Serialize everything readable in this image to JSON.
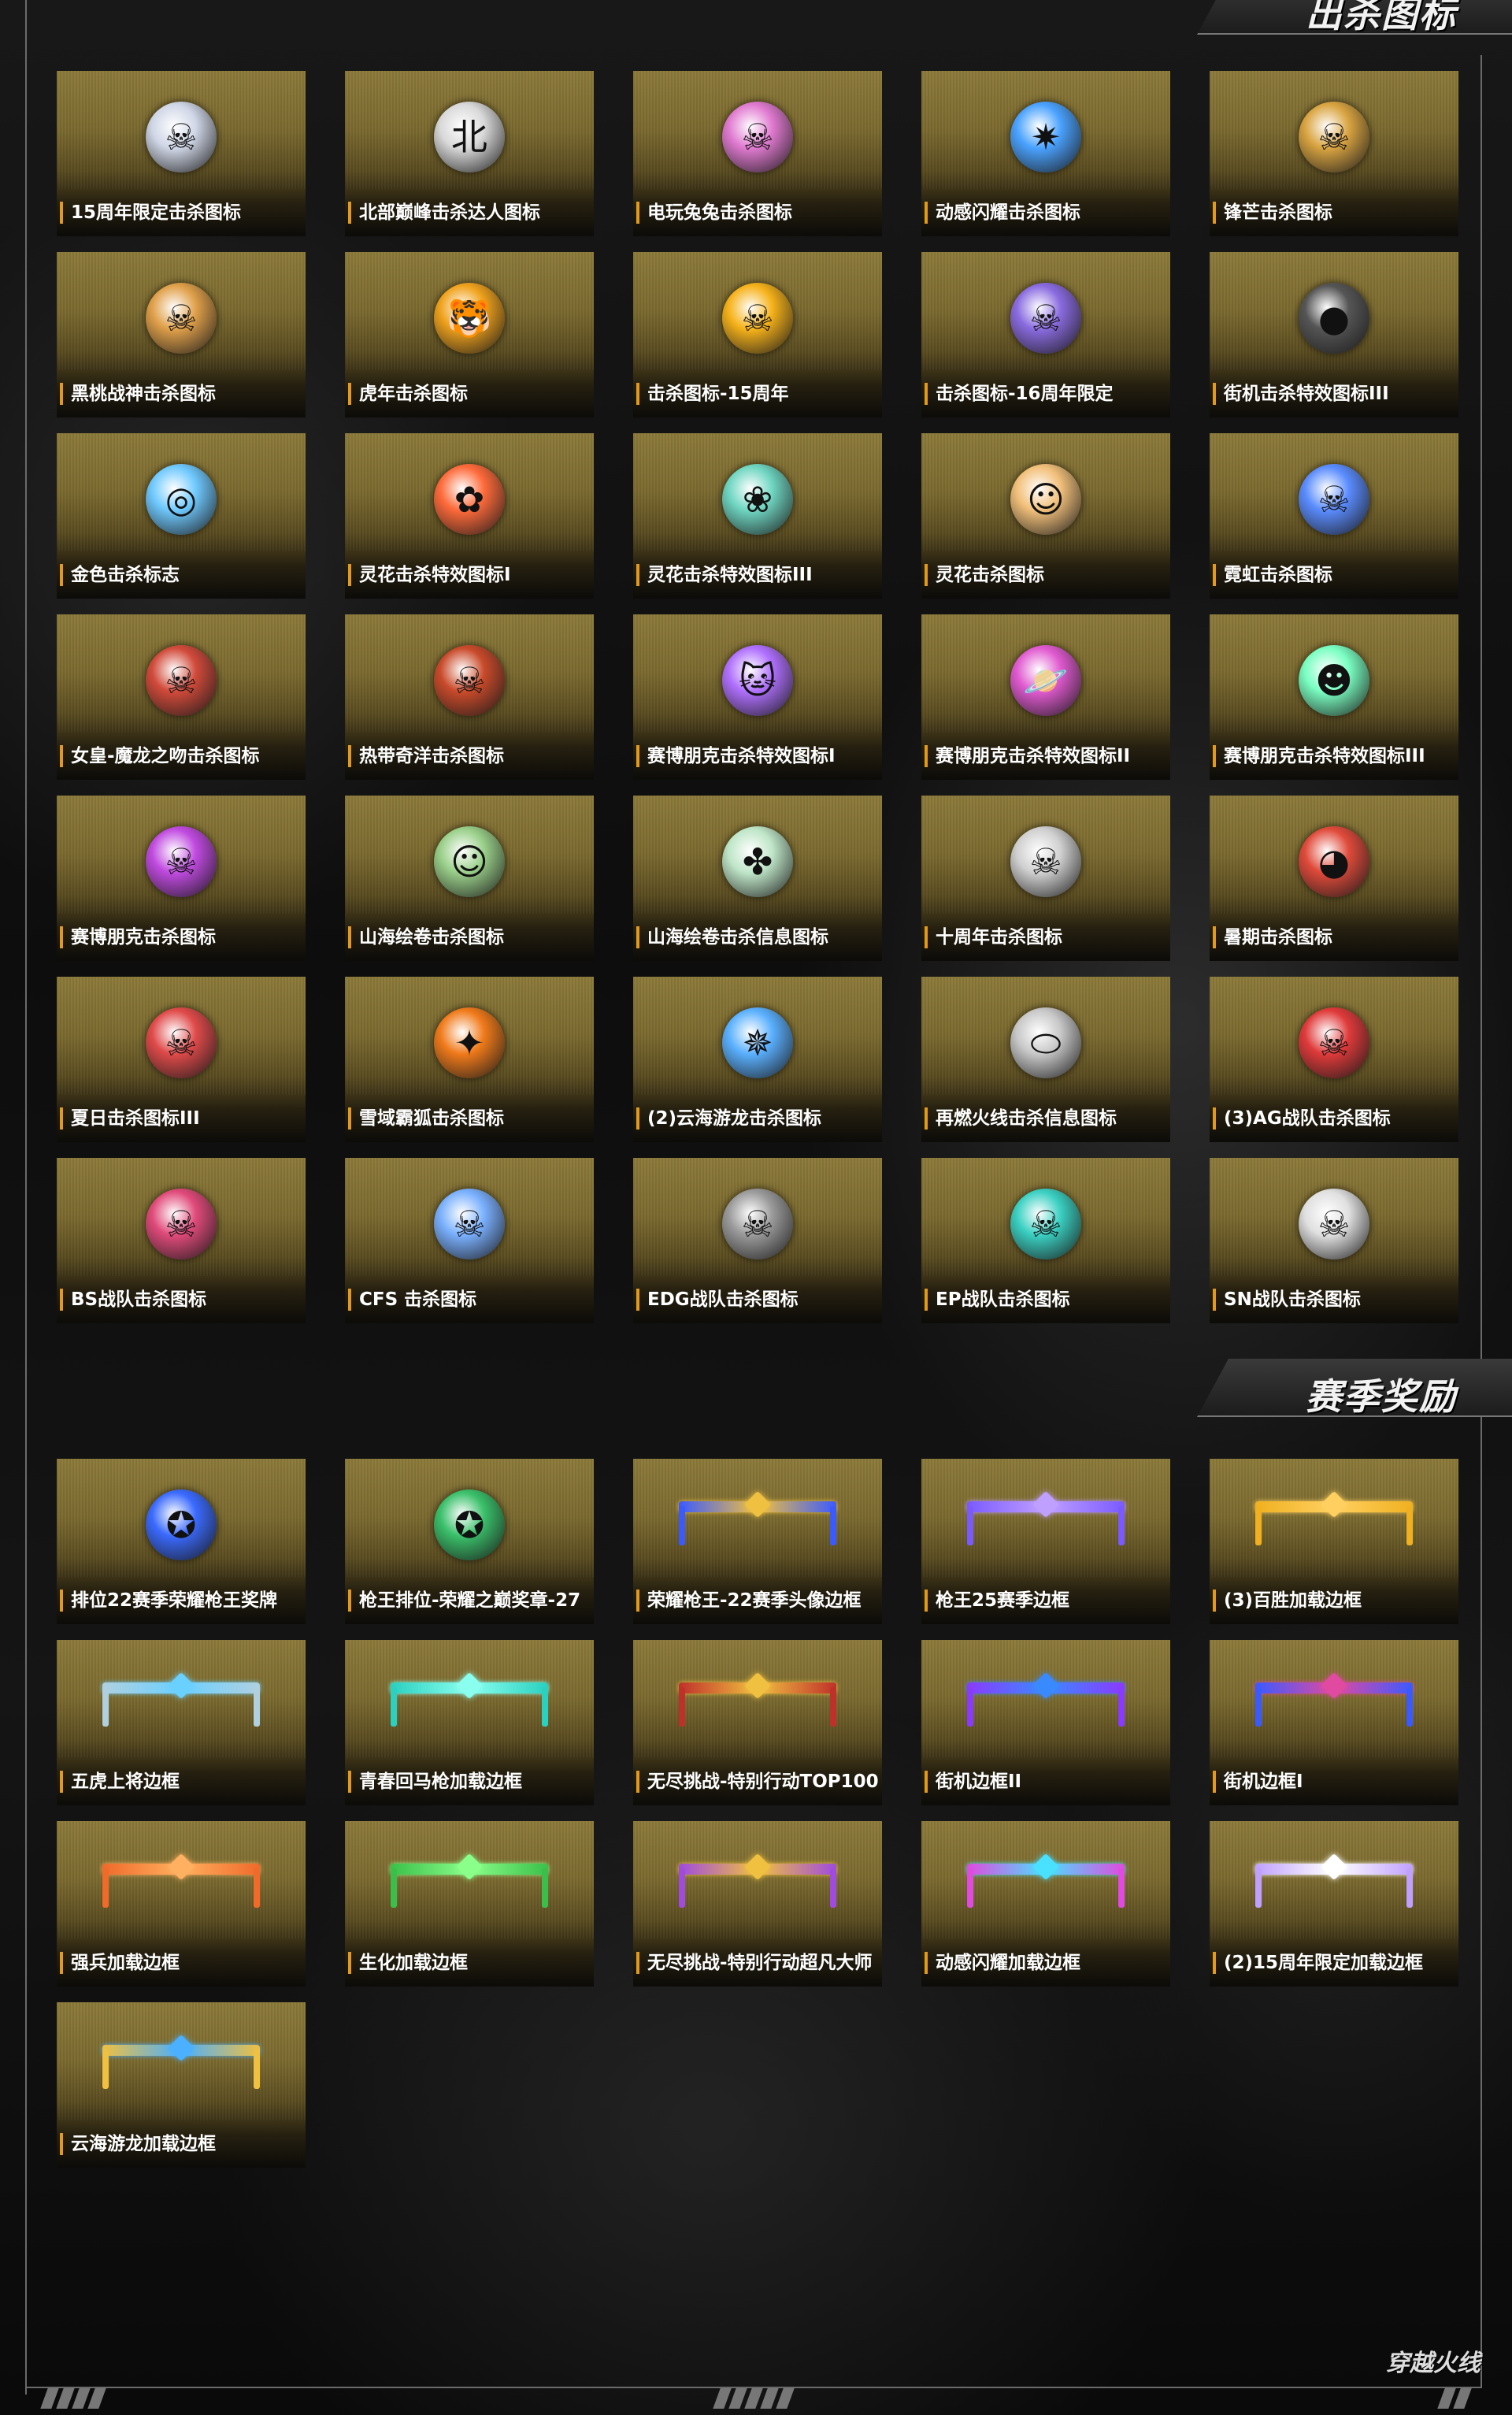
{
  "sections": [
    {
      "title": "出杀图标",
      "items": [
        {
          "label": "15周年限定击杀图标",
          "icon": "skull-sun-icon",
          "color": "#cfd6e6",
          "glyph": "☠"
        },
        {
          "label": "北部巅峰击杀达人图标",
          "icon": "bei-character-icon",
          "color": "#d9d9d9",
          "glyph": "北"
        },
        {
          "label": "电玩兔兔击杀图标",
          "icon": "skull-wings-pink-icon",
          "color": "#e07ad0",
          "glyph": "☠"
        },
        {
          "label": "动感闪耀击杀图标",
          "icon": "star-compass-icon",
          "color": "#4aa2ff",
          "glyph": "✷"
        },
        {
          "label": "锋芒击杀图标",
          "icon": "skull-golden-wings-icon",
          "color": "#d9a441",
          "glyph": "☠"
        },
        {
          "label": "黑桃战神击杀图标",
          "icon": "skull-beret-icon",
          "color": "#e0a04a",
          "glyph": "☠"
        },
        {
          "label": "虎年击杀图标",
          "icon": "tiger-badge-icon",
          "color": "#f0a21c",
          "glyph": "🐯"
        },
        {
          "label": "击杀图标-15周年",
          "icon": "skull-flame-wings-icon",
          "color": "#f6b21a",
          "glyph": "☠"
        },
        {
          "label": "击杀图标-16周年限定",
          "icon": "skull-purple-star-icon",
          "color": "#8a6be0",
          "glyph": "☠"
        },
        {
          "label": "街机击杀特效图标III",
          "icon": "bomb-icon",
          "color": "#555555",
          "glyph": "●"
        },
        {
          "label": "金色击杀标志",
          "icon": "target-compass-icon",
          "color": "#6fc9ff",
          "glyph": "◎"
        },
        {
          "label": "灵花击杀特效图标I",
          "icon": "red-flower-icon",
          "color": "#ff6a3a",
          "glyph": "✿"
        },
        {
          "label": "灵花击杀特效图标III",
          "icon": "teal-lotus-icon",
          "color": "#6fd6c2",
          "glyph": "❀"
        },
        {
          "label": "灵花击杀图标",
          "icon": "chibi-face-icon",
          "color": "#f2c07a",
          "glyph": "☺"
        },
        {
          "label": "霓虹击杀图标",
          "icon": "skull-neon-star-icon",
          "color": "#5a8cff",
          "glyph": "☠"
        },
        {
          "label": "女皇-魔龙之吻击杀图标",
          "icon": "skull-crown-icon",
          "color": "#d14a3a",
          "glyph": "☠"
        },
        {
          "label": "热带奇洋击杀图标",
          "icon": "skull-compass-icon",
          "color": "#c94a2a",
          "glyph": "☠"
        },
        {
          "label": "赛博朋克击杀特效图标I",
          "icon": "cyber-cat-icon",
          "color": "#b070ff",
          "glyph": "🐱"
        },
        {
          "label": "赛博朋克击杀特效图标II",
          "icon": "planet-icon",
          "color": "#e05ad0",
          "glyph": "🪐"
        },
        {
          "label": "赛博朋克击杀特效图标III",
          "icon": "neon-smiley-icon",
          "color": "#7affc2",
          "glyph": "☻"
        },
        {
          "label": "赛博朋克击杀图标",
          "icon": "skull-triangle-icon",
          "color": "#c04ae0",
          "glyph": "☠"
        },
        {
          "label": "山海绘卷击杀图标",
          "icon": "cat-badge-icon",
          "color": "#9ad08a",
          "glyph": "☺"
        },
        {
          "label": "山海绘卷击杀信息图标",
          "icon": "jade-pinwheel-icon",
          "color": "#bfe6c8",
          "glyph": "✤"
        },
        {
          "label": "十周年击杀图标",
          "icon": "skull-flowers-icon",
          "color": "#d0d0d0",
          "glyph": "☠"
        },
        {
          "label": "暑期击杀图标",
          "icon": "watermelon-icon",
          "color": "#e04a3a",
          "glyph": "◕"
        },
        {
          "label": "夏日击杀图标III",
          "icon": "skull-hibiscus-icon",
          "color": "#e04a4a",
          "glyph": "☠"
        },
        {
          "label": "雪域霸狐击杀图标",
          "icon": "fox-star-icon",
          "color": "#f07a1a",
          "glyph": "✦"
        },
        {
          "label": "(2)云海游龙击杀图标",
          "icon": "blue-compass-icon",
          "color": "#5ab0ff",
          "glyph": "✵"
        },
        {
          "label": "再燃火线击杀信息图标",
          "icon": "dog-tags-icon",
          "color": "#c8c8c8",
          "glyph": "⬭"
        },
        {
          "label": "(3)AG战队击杀图标",
          "icon": "skull-red-star-icon",
          "color": "#e03a3a",
          "glyph": "☠"
        },
        {
          "label": "BS战队击杀图标",
          "icon": "skull-pink-star-icon",
          "color": "#e04a7a",
          "glyph": "☠"
        },
        {
          "label": "CFS 击杀图标",
          "icon": "skull-blue-wings-icon",
          "color": "#7ab0ff",
          "glyph": "☠"
        },
        {
          "label": "EDG战队击杀图标",
          "icon": "skull-dark-star-icon",
          "color": "#9a9a9a",
          "glyph": "☠"
        },
        {
          "label": "EP战队击杀图标",
          "icon": "skull-teal-star-icon",
          "color": "#3ad0c2",
          "glyph": "☠"
        },
        {
          "label": "SN战队击杀图标",
          "icon": "skull-white-star-icon",
          "color": "#e0e0e0",
          "glyph": "☠"
        }
      ]
    },
    {
      "title": "赛季奖励",
      "items": [
        {
          "label": "排位22赛季荣耀枪王奖牌",
          "icon": "blue-gem-medal-icon",
          "color": "#3a6aff",
          "kind": "emblem",
          "glyph": "✪"
        },
        {
          "label": "枪王排位-荣耀之巅奖章-27",
          "icon": "green-gem-medal-icon",
          "color": "#3ac06a",
          "kind": "emblem",
          "glyph": "✪"
        },
        {
          "label": "荣耀枪王-22赛季头像边框",
          "icon": "blue-gold-wing-frame-icon",
          "color": "#3a5aff",
          "accent": "#f0c040",
          "kind": "frame"
        },
        {
          "label": "枪王25赛季边框",
          "icon": "purple-frame-icon",
          "color": "#7a5aff",
          "accent": "#c0a0ff",
          "kind": "frame"
        },
        {
          "label": "(3)百胜加载边框",
          "icon": "gold-frame-icon",
          "color": "#f0b020",
          "accent": "#ffd060",
          "kind": "frame"
        },
        {
          "label": "五虎上将边框",
          "icon": "silver-dragon-frame-icon",
          "color": "#b0d0e0",
          "accent": "#6ad0ff",
          "kind": "frame"
        },
        {
          "label": "青春回马枪加载边框",
          "icon": "teal-frame-icon",
          "color": "#2ad0c0",
          "accent": "#8affef",
          "kind": "frame"
        },
        {
          "label": "无尽挑战-特别行动TOP100",
          "icon": "red-gold-frame-icon",
          "color": "#c0302a",
          "accent": "#f0c040",
          "kind": "frame"
        },
        {
          "label": "街机边框II",
          "icon": "arcade-purple-frame-icon",
          "color": "#8a3aff",
          "accent": "#3a8aff",
          "kind": "frame"
        },
        {
          "label": "街机边框I",
          "icon": "arcade-blue-frame-icon",
          "color": "#3a5aff",
          "accent": "#e04aa0",
          "kind": "frame"
        },
        {
          "label": "强兵加载边框",
          "icon": "orange-frame-icon",
          "color": "#f06a2a",
          "accent": "#ffb060",
          "kind": "frame"
        },
        {
          "label": "生化加载边框",
          "icon": "green-frame-icon",
          "color": "#3ac04a",
          "accent": "#8aff8a",
          "kind": "frame"
        },
        {
          "label": "无尽挑战-特别行动超凡大师",
          "icon": "purple-gold-frame-icon",
          "color": "#a04ae0",
          "accent": "#f0c040",
          "kind": "frame"
        },
        {
          "label": "动感闪耀加载边框",
          "icon": "neon-star-frame-icon",
          "color": "#e04ae0",
          "accent": "#4ae0ff",
          "kind": "frame"
        },
        {
          "label": "(2)15周年限定加载边框",
          "icon": "anniversary-frame-icon",
          "color": "#c0a0ff",
          "accent": "#ffffff",
          "kind": "frame"
        },
        {
          "label": "云海游龙加载边框",
          "icon": "cloud-dragon-frame-icon",
          "color": "#f0c040",
          "accent": "#4ab0ff",
          "kind": "frame"
        }
      ]
    }
  ],
  "brand": {
    "logo_text": "穿越火线",
    "icon": "cf-logo-icon"
  },
  "colors": {
    "card_gold": "#8c7a3a",
    "label_accent": "#e39a1a",
    "background": "#0b0b0b"
  }
}
